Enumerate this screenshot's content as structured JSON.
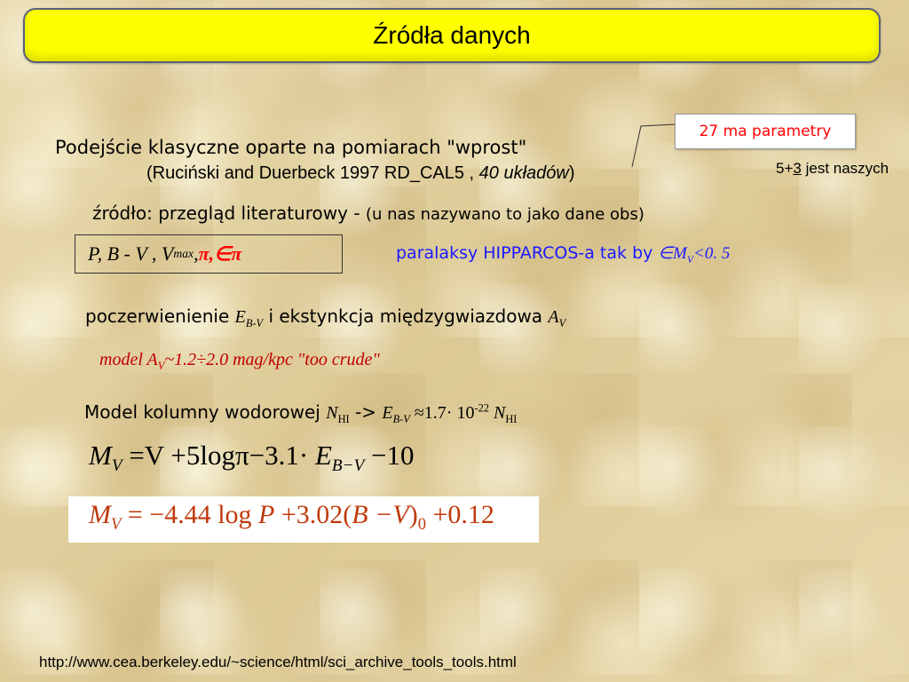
{
  "title": "Źródła danych",
  "line1": "Podejście klasyczne oparte na pomiarach \"wprost\"",
  "line2": {
    "open": "(",
    "main": "Ruciński and Duerbeck 1997 RD_CAL5 , ",
    "italic": "40 układów",
    "close": ")"
  },
  "callout": {
    "text": "27 ma parametry",
    "note_prefix": "5+",
    "note_underlined": "3",
    "note_suffix": " jest naszych"
  },
  "line3": {
    "main": "źródło: przegląd literaturowy - ",
    "paren": "(u nas nazywano to jako dane obs)"
  },
  "params_box": {
    "part1": "P, B - V , V",
    "sub": "max",
    "sep": " , ",
    "pi": "π,",
    "epi": " ∈π"
  },
  "hipparcos": {
    "text": "paralaksy HIPPARCOS-a tak by ",
    "cond_pre": "∈M",
    "cond_sub": "V",
    "cond_post": "<0. 5"
  },
  "line5": {
    "text": "poczerwienienie ",
    "e": "E",
    "e_sub": "B-V",
    "mid": " i ekstynkcja międzygwiazdowa ",
    "a": "A",
    "a_sub": "V"
  },
  "line6": {
    "pre": "model A",
    "sub": "V",
    "post": "~1.2÷2.0 mag/kpc \"too crude\""
  },
  "line7": {
    "text": "Model kolumny wodorowej ",
    "n": "N",
    "n_sub": "HI",
    "arrow": " -> ",
    "e": "E",
    "e_sub": "B-V",
    "approx": " ≈1.7· 10",
    "exp": "-22",
    "n2": " N",
    "n2_sub": "HI"
  },
  "eq1": {
    "m": "M",
    "m_sub": "V",
    "rest1": " =V +5log",
    "pi": "π",
    "rest2": "−3.1· ",
    "e": "E",
    "e_sub": "B−V",
    "rest3": " −10"
  },
  "eq2": {
    "m": "M",
    "m_sub": "V",
    "rest1": "  = −4.44 log ",
    "p": "P",
    "rest2": " +3.02(",
    "bv": "B −V",
    "rest3": ")",
    "zero": "0",
    "rest4": " +0.12"
  },
  "footer_url": "http://www.cea.berkeley.edu/~science/html/sci_archive_tools_tools.html"
}
